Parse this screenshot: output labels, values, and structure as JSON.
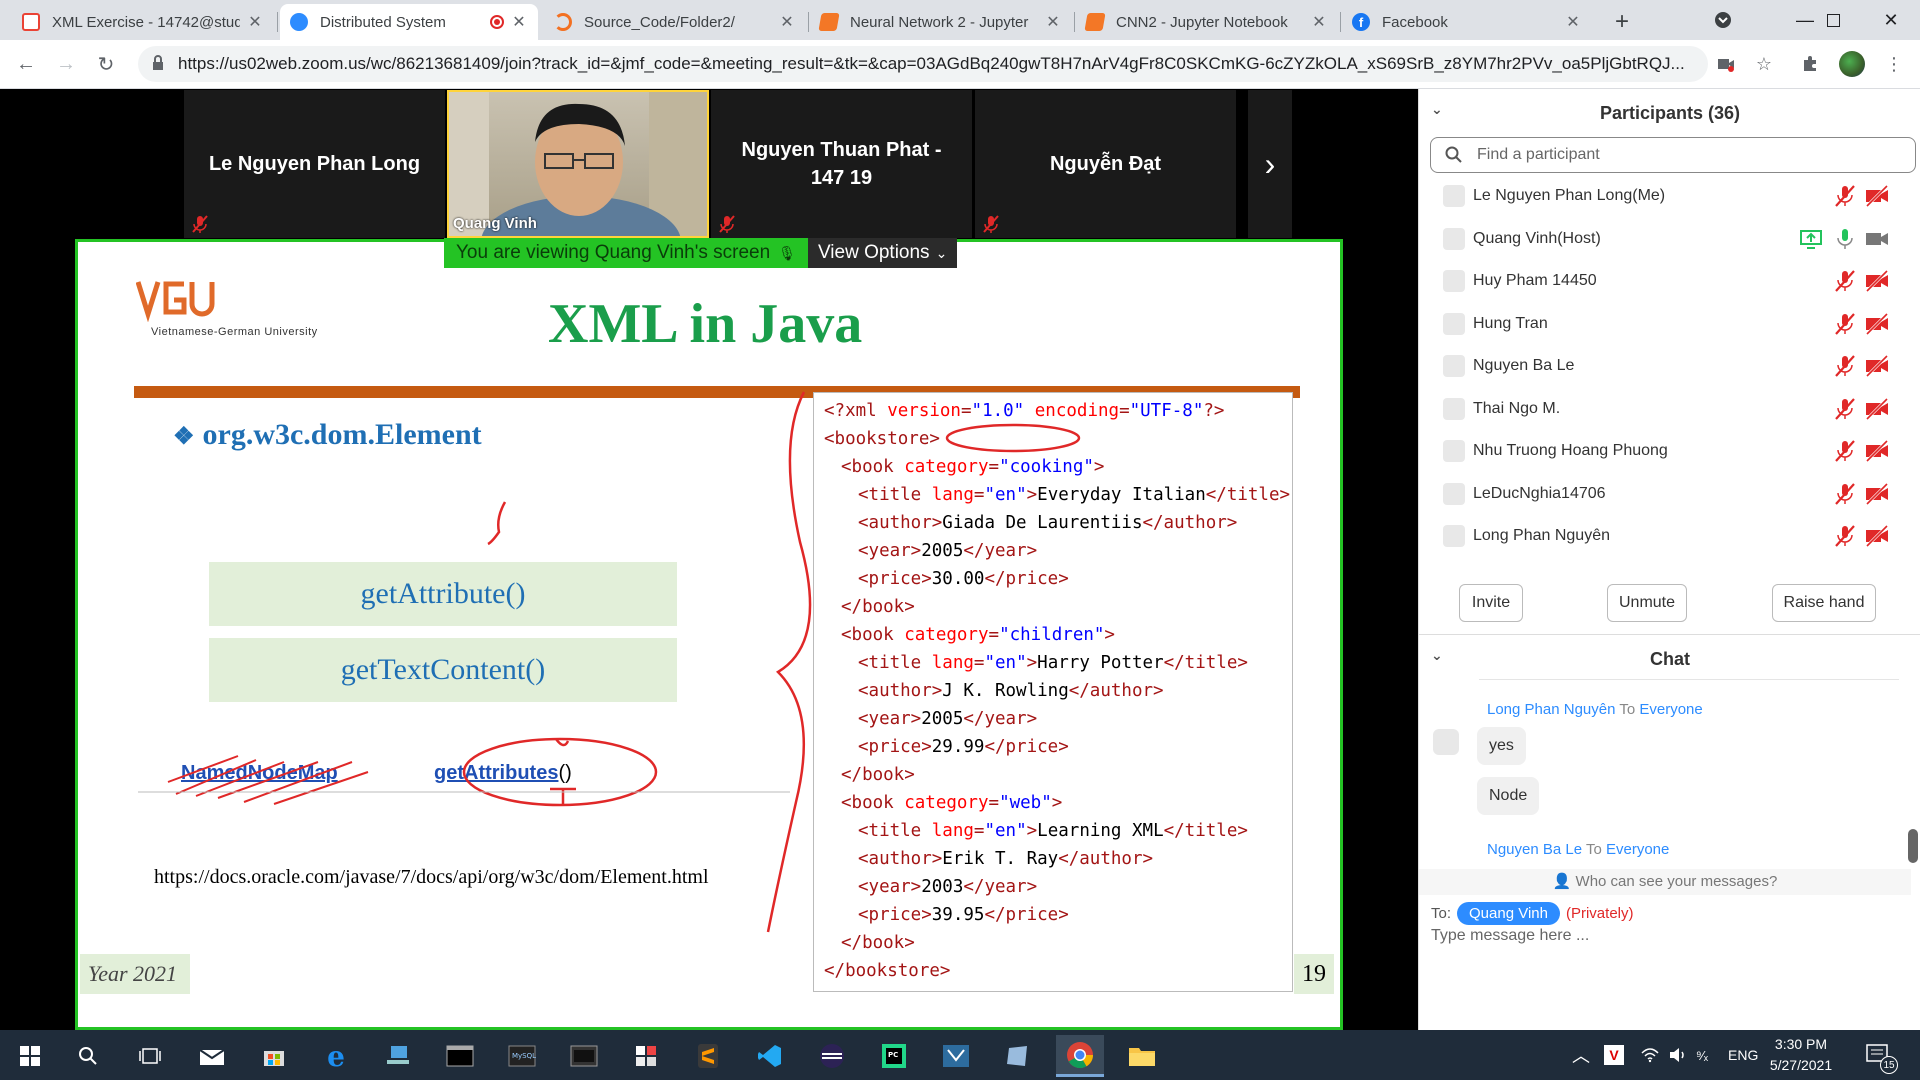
{
  "browser": {
    "tabs": [
      {
        "title": "XML Exercise - 14742@stud",
        "favicon_color": "#ea4335",
        "active": false
      },
      {
        "title": "Distributed System",
        "favicon_color": "#2d8cff",
        "active": true
      },
      {
        "title": "Source_Code/Folder2/",
        "favicon_color": "#f37021",
        "active": false
      },
      {
        "title": "Neural Network 2 - Jupyter",
        "favicon_color": "#f37726",
        "active": false
      },
      {
        "title": "CNN2 - Jupyter Notebook",
        "favicon_color": "#f37726",
        "active": false
      },
      {
        "title": "Facebook",
        "favicon_color": "#1877f2",
        "active": false
      }
    ],
    "new_tab_label": "+",
    "url": "https://us02web.zoom.us/wc/86213681409/join?track_id=&jmf_code=&meeting_result=&tk=&cap=03AGdBq240gwT8H7nArV4gFr8C0SKCmKG-6cZYZkOLA_xS69SrB_z8YM7hr2PVv_oa5PljGbtRQJ..."
  },
  "zoom": {
    "thumbnails": [
      {
        "name": "Le Nguyen Phan Long"
      },
      {
        "name": "Nguyen Thuan Phat - 147 19"
      },
      {
        "name": "Nguyễn Đạt"
      }
    ],
    "host_video_name": "Quang Vinh",
    "viewing_label": "You are viewing Quang Vinh's screen",
    "view_options_label": "View Options"
  },
  "slide": {
    "logo_text": "Vietnamese-German University",
    "title": "XML in Java",
    "bullet": "org.w3c.dom.Element",
    "methods": [
      "getAttribute()",
      "getTextContent()"
    ],
    "strike_link": "NamedNodeMap",
    "circled_link": "getAttributes",
    "circled_suffix": "()",
    "url": "https://docs.oracle.com/javase/7/docs/api/org/w3c/dom/Element.html",
    "year": "Year 2021",
    "page": "19",
    "code_lines": [
      {
        "indent": 0,
        "parts": [
          {
            "k": "tag",
            "t": "<?xml "
          },
          {
            "k": "attr",
            "t": "version"
          },
          {
            "k": "tag",
            "t": "="
          },
          {
            "k": "val",
            "t": "\"1.0\""
          },
          {
            "k": "txt",
            "t": " "
          },
          {
            "k": "attr",
            "t": "encoding"
          },
          {
            "k": "tag",
            "t": "="
          },
          {
            "k": "val",
            "t": "\"UTF-8\""
          },
          {
            "k": "tag",
            "t": "?>"
          }
        ]
      },
      {
        "indent": 0,
        "parts": [
          {
            "k": "tag",
            "t": "<bookstore>"
          }
        ]
      },
      {
        "indent": 2,
        "parts": [
          {
            "k": "tag",
            "t": "<book "
          },
          {
            "k": "attr",
            "t": "category"
          },
          {
            "k": "tag",
            "t": "="
          },
          {
            "k": "val",
            "t": "\"cooking\""
          },
          {
            "k": "tag",
            "t": ">"
          }
        ]
      },
      {
        "indent": 4,
        "parts": [
          {
            "k": "tag",
            "t": "<title "
          },
          {
            "k": "attr",
            "t": "lang"
          },
          {
            "k": "tag",
            "t": "="
          },
          {
            "k": "val",
            "t": "\"en\""
          },
          {
            "k": "tag",
            "t": ">"
          },
          {
            "k": "txt",
            "t": "Everyday Italian"
          },
          {
            "k": "tag",
            "t": "</title>"
          }
        ]
      },
      {
        "indent": 4,
        "parts": [
          {
            "k": "tag",
            "t": "<author>"
          },
          {
            "k": "txt",
            "t": "Giada De Laurentiis"
          },
          {
            "k": "tag",
            "t": "</author>"
          }
        ]
      },
      {
        "indent": 4,
        "parts": [
          {
            "k": "tag",
            "t": "<year>"
          },
          {
            "k": "txt",
            "t": "2005"
          },
          {
            "k": "tag",
            "t": "</year>"
          }
        ]
      },
      {
        "indent": 4,
        "parts": [
          {
            "k": "tag",
            "t": "<price>"
          },
          {
            "k": "txt",
            "t": "30.00"
          },
          {
            "k": "tag",
            "t": "</price>"
          }
        ]
      },
      {
        "indent": 2,
        "parts": [
          {
            "k": "tag",
            "t": "</book>"
          }
        ]
      },
      {
        "indent": 2,
        "parts": [
          {
            "k": "tag",
            "t": "<book "
          },
          {
            "k": "attr",
            "t": "category"
          },
          {
            "k": "tag",
            "t": "="
          },
          {
            "k": "val",
            "t": "\"children\""
          },
          {
            "k": "tag",
            "t": ">"
          }
        ]
      },
      {
        "indent": 4,
        "parts": [
          {
            "k": "tag",
            "t": "<title "
          },
          {
            "k": "attr",
            "t": "lang"
          },
          {
            "k": "tag",
            "t": "="
          },
          {
            "k": "val",
            "t": "\"en\""
          },
          {
            "k": "tag",
            "t": ">"
          },
          {
            "k": "txt",
            "t": "Harry Potter"
          },
          {
            "k": "tag",
            "t": "</title>"
          }
        ]
      },
      {
        "indent": 4,
        "parts": [
          {
            "k": "tag",
            "t": "<author>"
          },
          {
            "k": "txt",
            "t": "J K. Rowling"
          },
          {
            "k": "tag",
            "t": "</author>"
          }
        ]
      },
      {
        "indent": 4,
        "parts": [
          {
            "k": "tag",
            "t": "<year>"
          },
          {
            "k": "txt",
            "t": "2005"
          },
          {
            "k": "tag",
            "t": "</year>"
          }
        ]
      },
      {
        "indent": 4,
        "parts": [
          {
            "k": "tag",
            "t": "<price>"
          },
          {
            "k": "txt",
            "t": "29.99"
          },
          {
            "k": "tag",
            "t": "</price>"
          }
        ]
      },
      {
        "indent": 2,
        "parts": [
          {
            "k": "tag",
            "t": "</book>"
          }
        ]
      },
      {
        "indent": 2,
        "parts": [
          {
            "k": "tag",
            "t": "<book "
          },
          {
            "k": "attr",
            "t": "category"
          },
          {
            "k": "tag",
            "t": "="
          },
          {
            "k": "val",
            "t": "\"web\""
          },
          {
            "k": "tag",
            "t": ">"
          }
        ]
      },
      {
        "indent": 4,
        "parts": [
          {
            "k": "tag",
            "t": "<title "
          },
          {
            "k": "attr",
            "t": "lang"
          },
          {
            "k": "tag",
            "t": "="
          },
          {
            "k": "val",
            "t": "\"en\""
          },
          {
            "k": "tag",
            "t": ">"
          },
          {
            "k": "txt",
            "t": "Learning XML"
          },
          {
            "k": "tag",
            "t": "</title>"
          }
        ]
      },
      {
        "indent": 4,
        "parts": [
          {
            "k": "tag",
            "t": "<author>"
          },
          {
            "k": "txt",
            "t": "Erik T. Ray"
          },
          {
            "k": "tag",
            "t": "</author>"
          }
        ]
      },
      {
        "indent": 4,
        "parts": [
          {
            "k": "tag",
            "t": "<year>"
          },
          {
            "k": "txt",
            "t": "2003"
          },
          {
            "k": "tag",
            "t": "</year>"
          }
        ]
      },
      {
        "indent": 4,
        "parts": [
          {
            "k": "tag",
            "t": "<price>"
          },
          {
            "k": "txt",
            "t": "39.95"
          },
          {
            "k": "tag",
            "t": "</price>"
          }
        ]
      },
      {
        "indent": 2,
        "parts": [
          {
            "k": "tag",
            "t": "</book>"
          }
        ]
      },
      {
        "indent": 0,
        "parts": [
          {
            "k": "tag",
            "t": "</bookstore>"
          }
        ]
      }
    ]
  },
  "panel": {
    "participants_title": "Participants (36)",
    "find_placeholder": "Find a participant",
    "participants": [
      {
        "name": "Le Nguyen Phan Long(Me)",
        "host": false
      },
      {
        "name": "Quang Vinh(Host)",
        "host": true
      },
      {
        "name": "Huy Pham 14450",
        "host": false
      },
      {
        "name": "Hung Tran",
        "host": false
      },
      {
        "name": "Nguyen Ba Le",
        "host": false
      },
      {
        "name": "Thai Ngo M.",
        "host": false
      },
      {
        "name": "Nhu Truong Hoang Phuong",
        "host": false
      },
      {
        "name": "LeDucNghia14706",
        "host": false
      },
      {
        "name": "Long Phan Nguyên",
        "host": false
      }
    ],
    "buttons": {
      "invite": "Invite",
      "unmute": "Unmute",
      "raise_hand": "Raise hand"
    },
    "chat_title": "Chat",
    "messages": [
      {
        "sender": "Long Phan Nguyên",
        "to_word": "To",
        "recipient": "Everyone",
        "bubbles": [
          "yes",
          "Node"
        ]
      },
      {
        "sender": "Nguyen Ba Le",
        "to_word": "To",
        "recipient": "Everyone",
        "bubbles": []
      }
    ],
    "who_can_see": "Who can see your messages?",
    "to_label": "To:",
    "to_recipient": "Quang Vinh",
    "privately": "(Privately)",
    "input_placeholder": "Type message here ..."
  },
  "taskbar": {
    "lang": "ENG",
    "time": "3:30 PM",
    "date": "5/27/2021",
    "notifications": "15"
  },
  "colors": {
    "zoom_blue": "#2d8cff",
    "share_green": "#24c324",
    "slide_title_green": "#1a9e4b",
    "slide_orange": "#c55a11",
    "mute_red": "#e02828"
  }
}
